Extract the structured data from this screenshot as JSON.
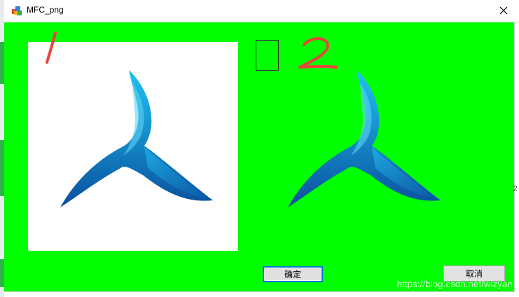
{
  "window": {
    "title": "MFC_png",
    "close_glyph": "✕",
    "icon": "mfc-app-icon"
  },
  "colors": {
    "client_background": "#00ff00",
    "picture_background": "#ffffff",
    "handwriting": "#e8453c",
    "logo_light": "#1fb6ea",
    "logo_dark": "#0a4f9e"
  },
  "annotations": {
    "mark_1": "1",
    "mark_2": "2"
  },
  "buttons": {
    "ok_label": "确定",
    "cancel_label": "取消"
  },
  "watermark": "https://blog.csdn.net/wizyan",
  "edge_text": "2"
}
